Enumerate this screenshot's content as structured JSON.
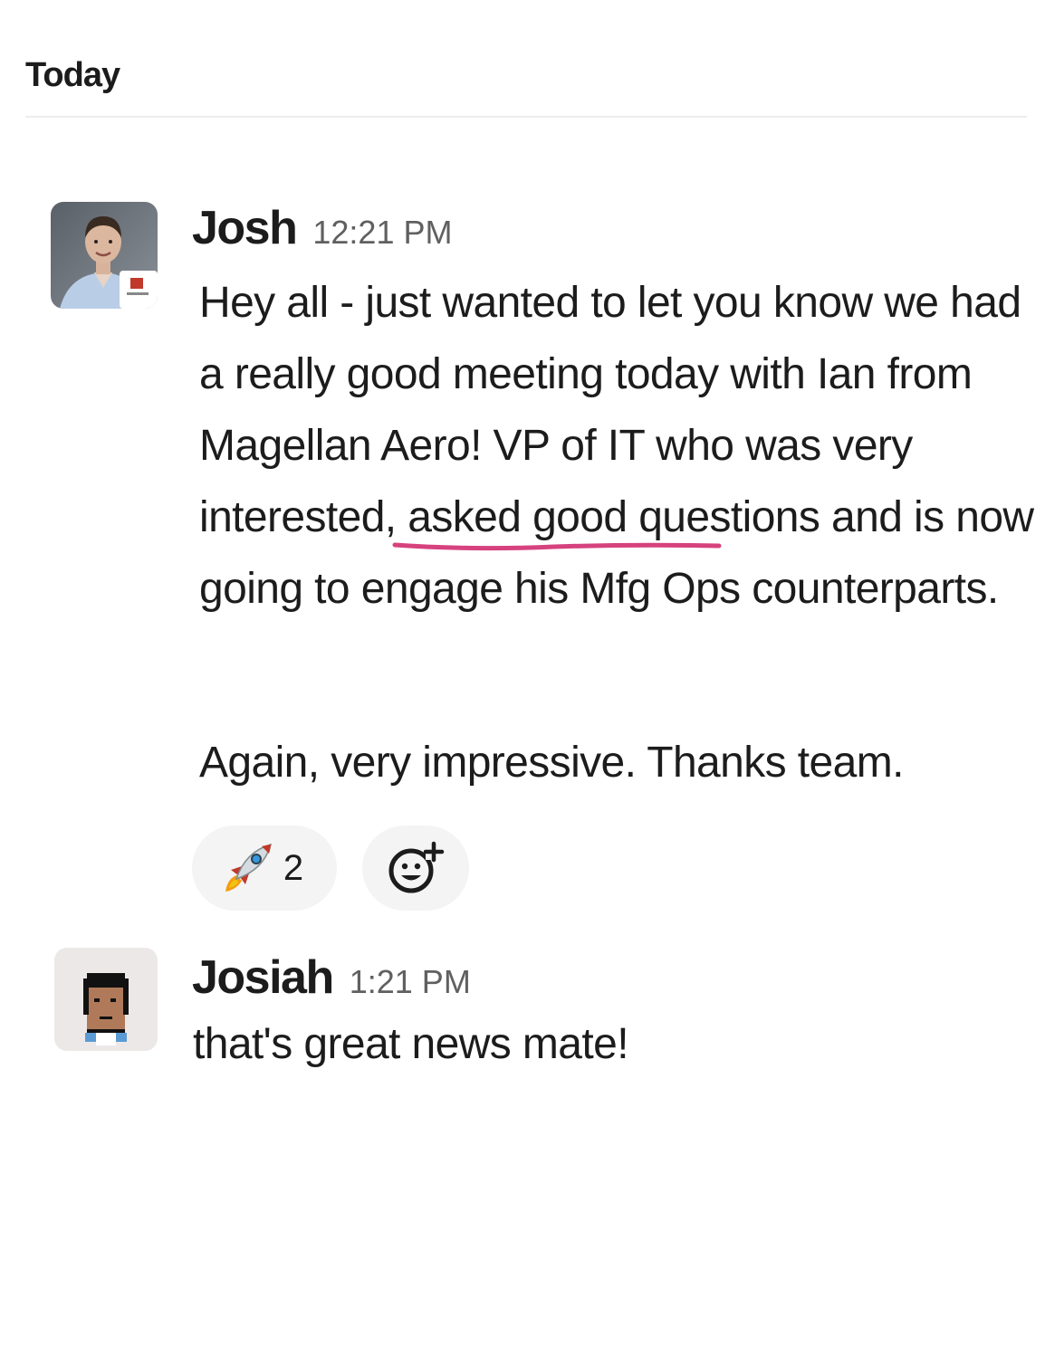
{
  "day_divider": {
    "label": "Today"
  },
  "messages": [
    {
      "author": "Josh",
      "time": "12:21 PM",
      "avatar": "josh-avatar-photo",
      "paragraphs": [
        "Hey all - just wanted to let you know we had a really good meeting today with Ian from Magellan Aero! VP of IT who was very interested, asked good questions and is now going to engage his Mfg Ops counterparts.",
        "Again, very impressive. Thanks team."
      ],
      "reactions": [
        {
          "emoji": "rocket-icon",
          "count": "2"
        }
      ],
      "add_reaction_icon": "add-reaction-icon"
    },
    {
      "author": "Josiah",
      "time": "1:21 PM",
      "avatar": "pixel-art-avatar",
      "paragraphs": [
        "that's great news mate!"
      ]
    }
  ],
  "colors": {
    "underline": "#d6427e",
    "reaction_bg": "#f4f4f4",
    "timestamp": "#616061"
  }
}
